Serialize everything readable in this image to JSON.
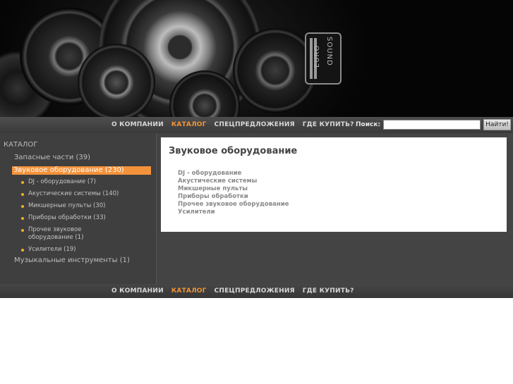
{
  "logo": {
    "word_left": "EURO",
    "word_right": "SOUND"
  },
  "nav": {
    "items": [
      {
        "label": "О КОМПАНИИ",
        "active": false
      },
      {
        "label": "КАТАЛОГ",
        "active": true
      },
      {
        "label": "СПЕЦПРЕДЛОЖЕНИЯ",
        "active": false
      },
      {
        "label": "ГДЕ КУПИТЬ?",
        "active": false
      }
    ]
  },
  "search": {
    "label": "Поиск:",
    "value": "",
    "button": "Найти!"
  },
  "sidebar": {
    "title": "КАТАЛОГ",
    "items": [
      {
        "label": "Запасные части (39)"
      },
      {
        "label": "Звуковое оборудование (230)"
      },
      {
        "label": "Музыкальные инструменты (1)"
      }
    ],
    "subitems": [
      "DJ - оборудование (7)",
      "Акустические системы (140)",
      "Микшерные пульты (30)",
      "Приборы обработки (33)",
      "Прочее звуковое оборудование (1)",
      "Усилители (19)"
    ]
  },
  "content": {
    "title": "Звуковое оборудование",
    "links": [
      "DJ - оборудование",
      "Акустические системы",
      "Микшерные пульты",
      "Приборы обработки",
      "Прочее звуковое оборудование",
      "Усилители"
    ]
  },
  "colors": {
    "accent": "#f4923a",
    "bullet": "#f0b030"
  }
}
